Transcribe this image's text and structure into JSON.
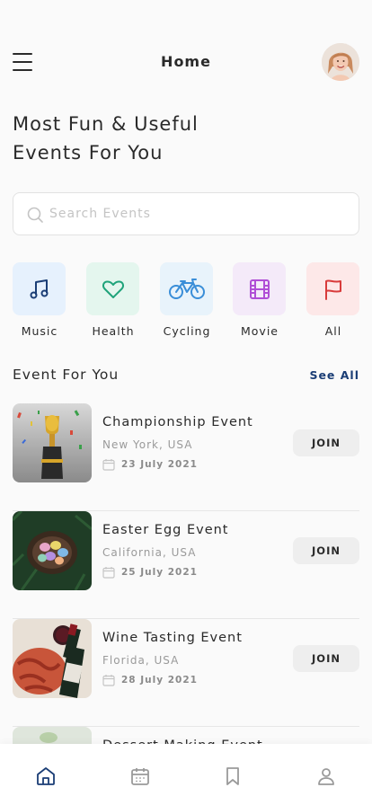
{
  "header": {
    "title": "Home",
    "menu_icon": "hamburger-icon",
    "avatar": "user-avatar"
  },
  "hero": {
    "line1": "Most Fun & Useful",
    "line2": "Events For You"
  },
  "search": {
    "placeholder": "Search Events",
    "value": "",
    "icon": "search-icon"
  },
  "categories": [
    {
      "label": "Music",
      "icon": "music-note-icon",
      "bg": "#e6f1fd",
      "color": "#1a3d75"
    },
    {
      "label": "Health",
      "icon": "heart-icon",
      "bg": "#e4f6ee",
      "color": "#1fa37a"
    },
    {
      "label": "Cycling",
      "icon": "bicycle-icon",
      "bg": "#e8f3fb",
      "color": "#3a8ed8"
    },
    {
      "label": "Movie",
      "icon": "film-icon",
      "bg": "#f4eaf9",
      "color": "#b04fd6"
    },
    {
      "label": "All",
      "icon": "flag-icon",
      "bg": "#fde8e8",
      "color": "#d83b3b"
    }
  ],
  "section": {
    "title": "Event For You",
    "see_all": "See All"
  },
  "events": [
    {
      "title": "Championship Event",
      "location": "New York, USA",
      "date": "23 July 2021",
      "action": "JOIN",
      "image": "trophy-image"
    },
    {
      "title": "Easter Egg Event",
      "location": "California, USA",
      "date": "25 July 2021",
      "action": "JOIN",
      "image": "easter-eggs-image"
    },
    {
      "title": "Wine Tasting Event",
      "location": "Florida, USA",
      "date": "28 July 2021",
      "action": "JOIN",
      "image": "wine-image"
    },
    {
      "title": "Dessert Making Event",
      "location": "",
      "date": "",
      "action": "",
      "image": "dessert-image"
    }
  ],
  "bottom_nav": [
    {
      "icon": "home-icon",
      "active": true
    },
    {
      "icon": "calendar-icon",
      "active": false
    },
    {
      "icon": "bookmark-icon",
      "active": false
    },
    {
      "icon": "profile-icon",
      "active": false
    }
  ],
  "colors": {
    "accent": "#1a3d75",
    "inactive": "#9a9a9a"
  }
}
